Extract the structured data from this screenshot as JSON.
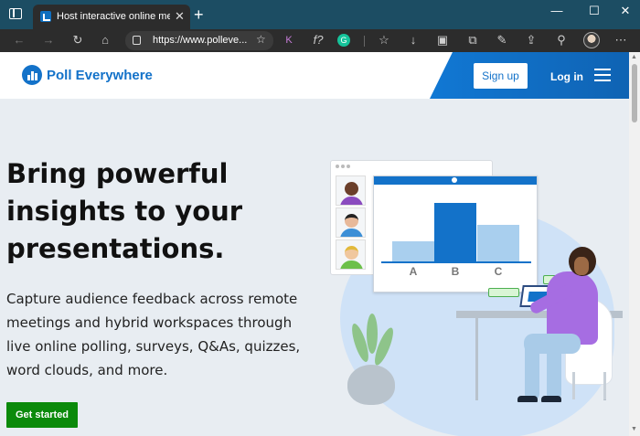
{
  "browser": {
    "tab_title": "Host interactive online meetings",
    "tab_close": "✕",
    "new_tab": "+",
    "address": "https://www.polleve...",
    "window_controls": [
      "—",
      "☐",
      "✕"
    ]
  },
  "header": {
    "logo": "Poll Everywhere",
    "signup": "Sign up",
    "login": "Log in"
  },
  "hero": {
    "title": "Bring powerful insights to your presentations.",
    "subtitle": "Capture audience feedback across remote meetings and hybrid workspaces through live online polling, surveys, Q&As, quizzes, word clouds, and more.",
    "cta": "Get started"
  },
  "illustration": {
    "chart_labels": [
      "A",
      "B",
      "C"
    ],
    "chart_values": [
      0.34,
      0.97,
      0.61
    ]
  },
  "colors": {
    "brand_blue": "#1372c9",
    "cta_green": "#0b8a0b",
    "bar_light": "#a9cfee"
  }
}
